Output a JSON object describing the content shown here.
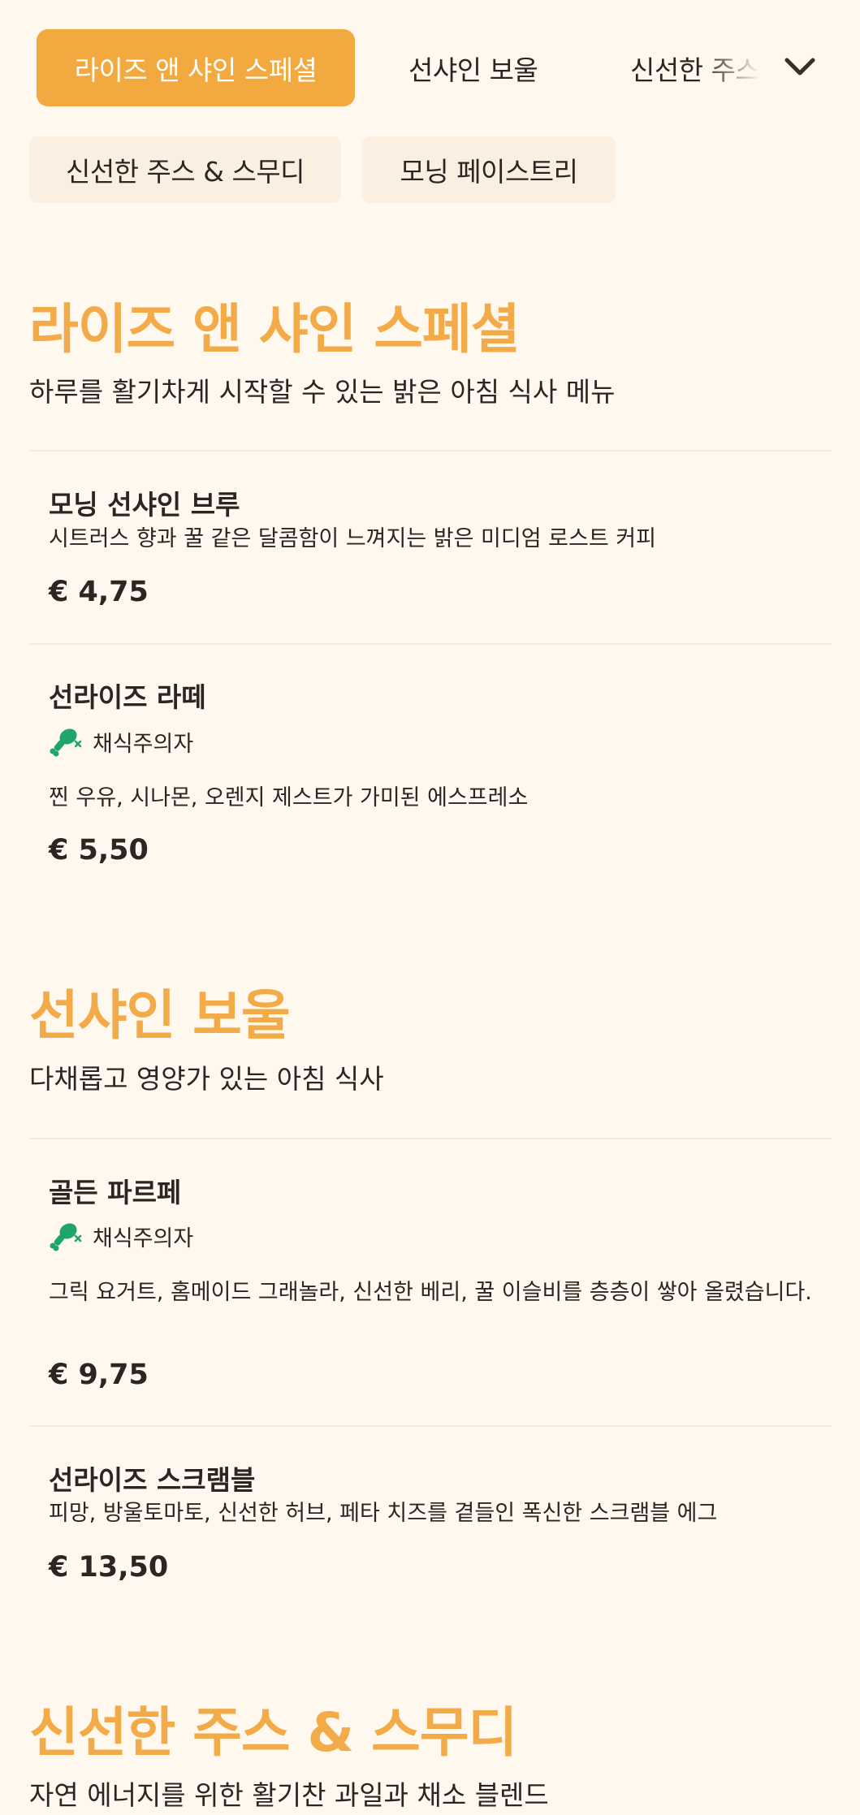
{
  "nav": {
    "tabs": [
      {
        "label": "라이즈 앤 샤인 스페셜",
        "active": true
      },
      {
        "label": "선샤인 보울",
        "active": false
      },
      {
        "label": "신선한 주스 & 스무디",
        "active": false
      }
    ],
    "overflow": [
      {
        "label": "신선한 주스 & 스무디"
      },
      {
        "label": "모닝 페이스트리"
      }
    ],
    "expand_icon": "chevron-down-icon"
  },
  "colors": {
    "accent": "#f2a93f",
    "background": "#fff8ee",
    "vegetarian_icon": "#1ea56a"
  },
  "sections": [
    {
      "title": "라이즈 앤 샤인 스페셜",
      "subtitle": "하루를 활기차게 시작할 수 있는 밝은 아침 식사 메뉴",
      "items": [
        {
          "name": "모닝 선샤인 브루",
          "description": "시트러스 향과 꿀 같은 달콤함이 느껴지는 밝은 미디엄 로스트 커피",
          "price": "€ 4,75"
        },
        {
          "name": "선라이즈 라떼",
          "tag": "채식주의자",
          "tag_icon": "vegetarian-drumstick-icon",
          "description": "찐 우유, 시나몬, 오렌지 제스트가 가미된 에스프레소",
          "price": "€ 5,50"
        }
      ]
    },
    {
      "title": "선샤인 보울",
      "subtitle": "다채롭고 영양가 있는 아침 식사",
      "items": [
        {
          "name": "골든 파르페",
          "tag": "채식주의자",
          "tag_icon": "vegetarian-drumstick-icon",
          "description": "그릭 요거트, 홈메이드 그래놀라, 신선한 베리, 꿀 이슬비를 층층이 쌓아 올렸습니다.",
          "price": "€ 9,75"
        },
        {
          "name": "선라이즈 스크램블",
          "description": "피망, 방울토마토, 신선한 허브, 페타 치즈를 곁들인 폭신한 스크램블 에그",
          "price": "€ 13,50"
        }
      ]
    },
    {
      "title": "신선한 주스 & 스무디",
      "subtitle": "자연 에너지를 위한 활기찬 과일과 채소 블렌드"
    }
  ]
}
